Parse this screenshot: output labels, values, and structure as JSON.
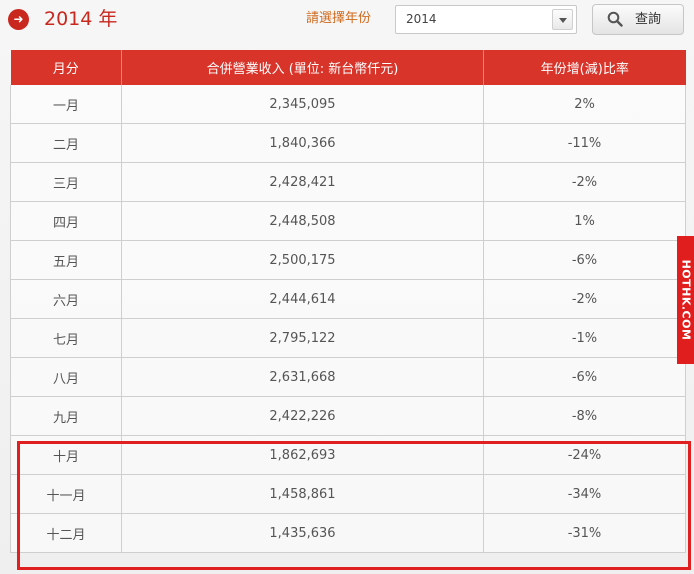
{
  "header": {
    "title": "2014 年",
    "select_label": "請選擇年份",
    "selected_year": "2014",
    "query_button": "查詢"
  },
  "table": {
    "columns": [
      "月分",
      "合併營業收入 (單位: 新台幣仟元)",
      "年份增(減)比率"
    ],
    "rows": [
      {
        "month": "一月",
        "revenue": "2,345,095",
        "change": "2%"
      },
      {
        "month": "二月",
        "revenue": "1,840,366",
        "change": "-11%"
      },
      {
        "month": "三月",
        "revenue": "2,428,421",
        "change": "-2%"
      },
      {
        "month": "四月",
        "revenue": "2,448,508",
        "change": "1%"
      },
      {
        "month": "五月",
        "revenue": "2,500,175",
        "change": "-6%"
      },
      {
        "month": "六月",
        "revenue": "2,444,614",
        "change": "-2%"
      },
      {
        "month": "七月",
        "revenue": "2,795,122",
        "change": "-1%"
      },
      {
        "month": "八月",
        "revenue": "2,631,668",
        "change": "-6%"
      },
      {
        "month": "九月",
        "revenue": "2,422,226",
        "change": "-8%"
      },
      {
        "month": "十月",
        "revenue": "1,862,693",
        "change": "-24%"
      },
      {
        "month": "十一月",
        "revenue": "1,458,861",
        "change": "-34%"
      },
      {
        "month": "十二月",
        "revenue": "1,435,636",
        "change": "-31%"
      }
    ]
  },
  "watermark": "HOTHK.COM",
  "colors": {
    "accent": "#c8281e",
    "header_bg": "#d8342a",
    "highlight_border": "#e02020",
    "label_orange": "#d06a1e"
  }
}
